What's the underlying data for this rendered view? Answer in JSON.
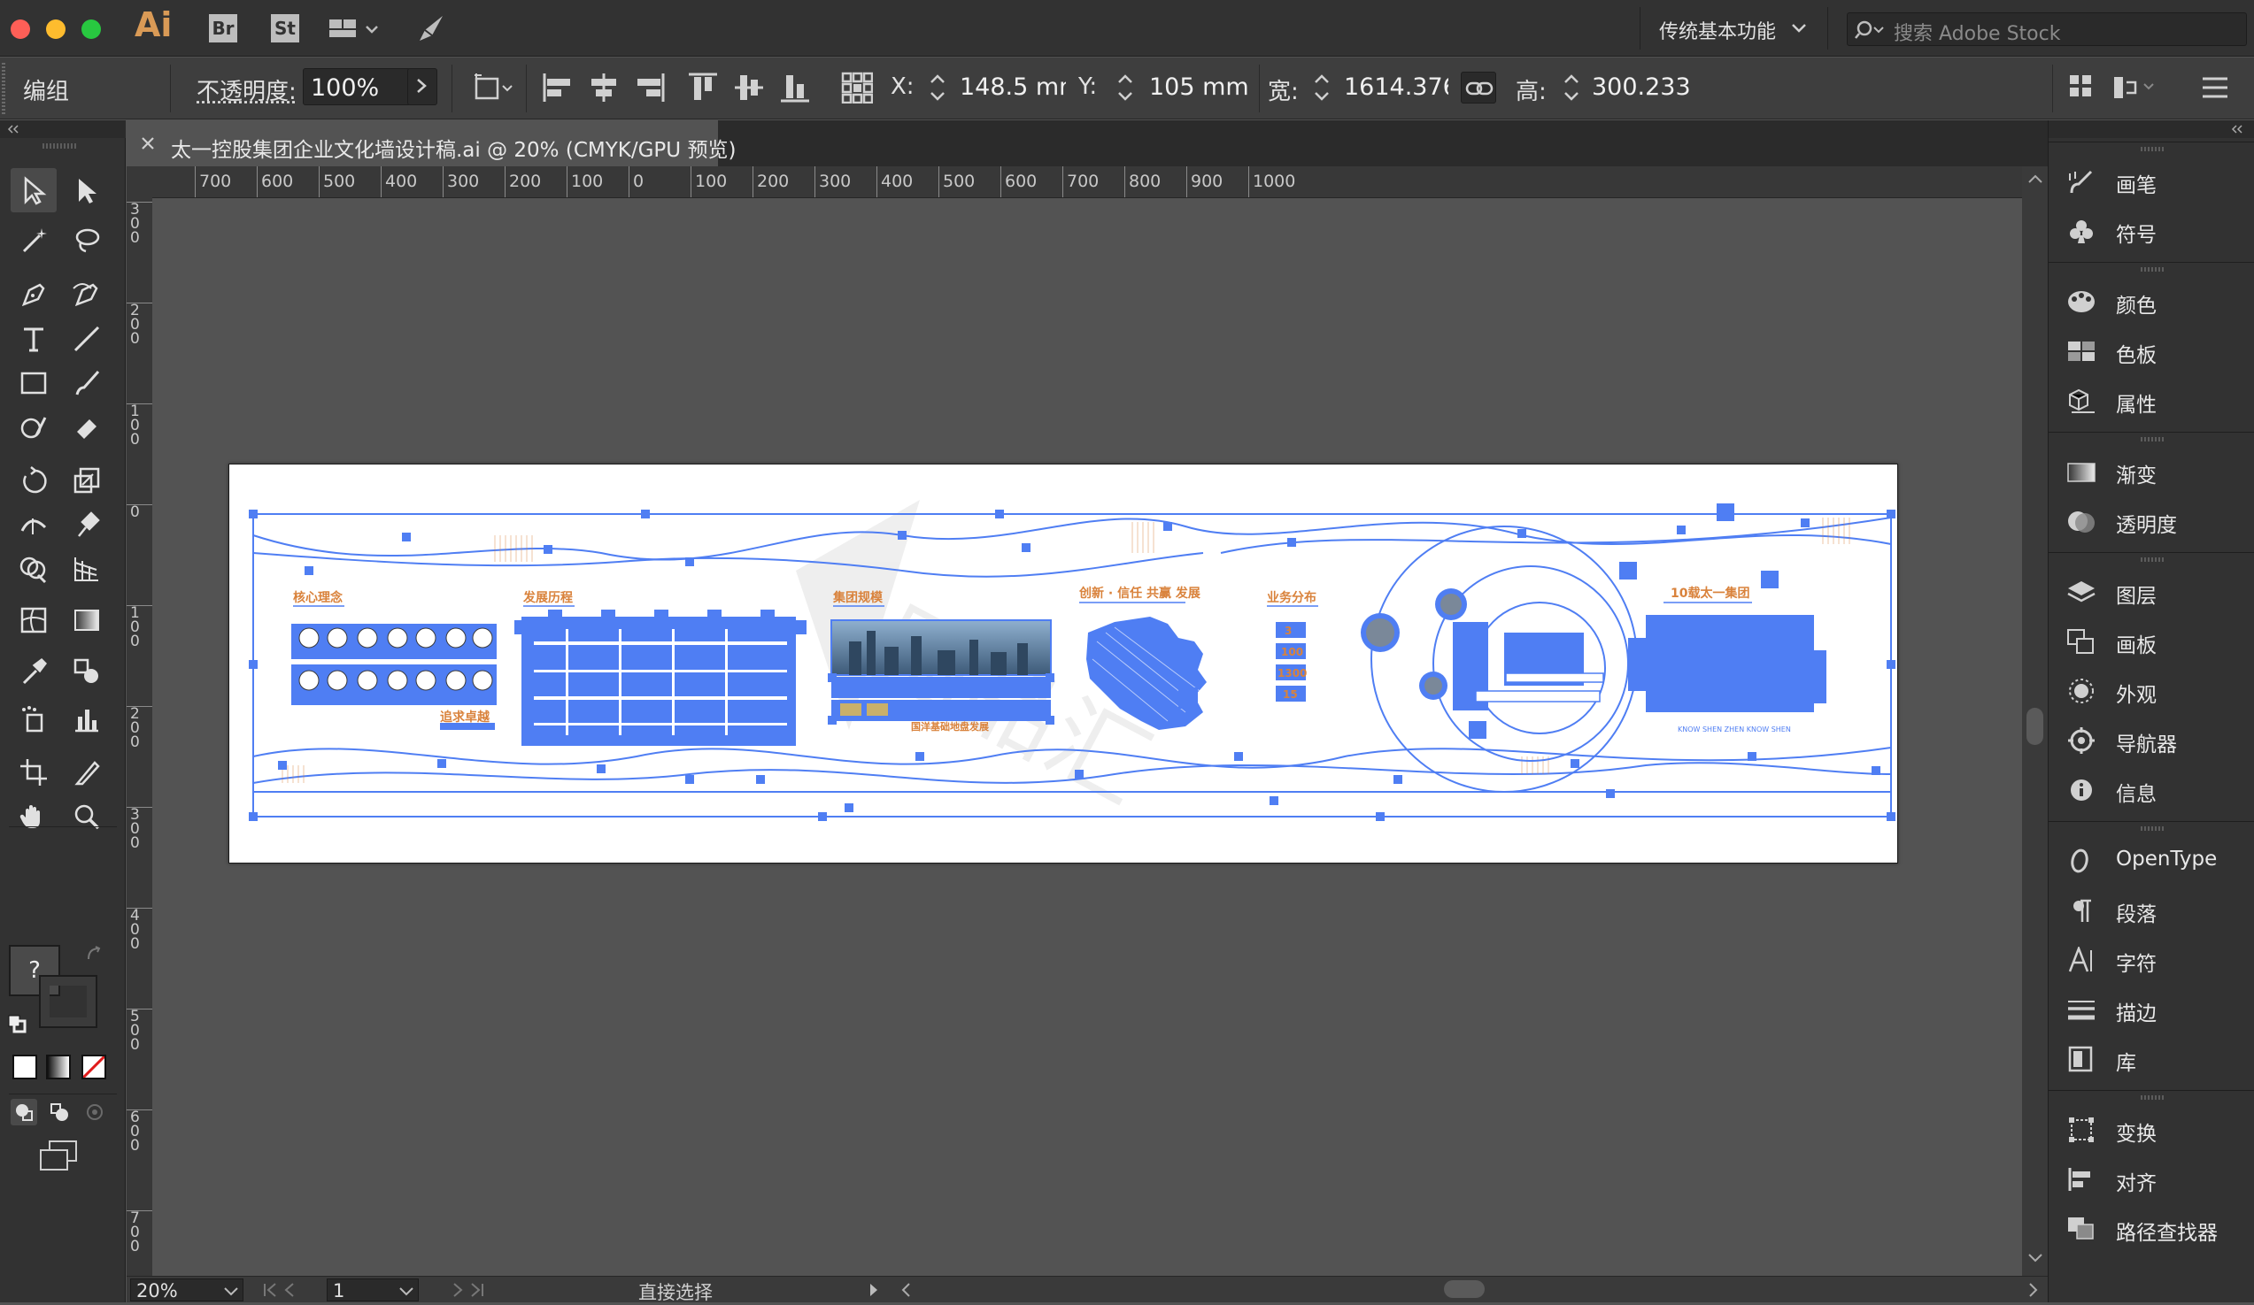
{
  "app": {
    "logo": "Ai",
    "workspace": "传统基本功能",
    "search_placeholder": "搜索 Adobe Stock"
  },
  "titlebar_apps": [
    "Br",
    "St"
  ],
  "control": {
    "selection_type": "编组",
    "opacity_label": "不透明度:",
    "opacity_value": "100%",
    "x_label": "X:",
    "x_value": "148.5 mm",
    "y_label": "Y:",
    "y_value": "105 mm",
    "w_label": "宽:",
    "w_value": "1614.376",
    "h_label": "高:",
    "h_value": "300.233 n"
  },
  "document": {
    "tab_title": "太一控股集团企业文化墙设计稿.ai @ 20% (CMYK/GPU 预览)"
  },
  "ruler": {
    "h_ticks": [
      "700",
      "600",
      "500",
      "400",
      "300",
      "200",
      "100",
      "0",
      "100",
      "200",
      "300",
      "400",
      "500",
      "600",
      "700",
      "800",
      "900",
      "1000"
    ],
    "v_ticks": [
      "300",
      "200",
      "100",
      "0",
      "100",
      "200",
      "300",
      "400",
      "500",
      "600",
      "700"
    ]
  },
  "artwork": {
    "sections": [
      "核心理念",
      "发展历程",
      "集团规模",
      "创新 · 信任 共赢 发展",
      "业务分布",
      "10载太一集团"
    ],
    "subtitles": [
      "追求卓越",
      "国洋基础地盘发展"
    ],
    "stats": [
      "3",
      "100",
      "1300",
      "15"
    ],
    "footer_caption": "KNOW SHEN ZHEN KNOW SHEN"
  },
  "toolbar_fill_hint": "?",
  "status": {
    "zoom": "20%",
    "artboard": "1",
    "tool": "直接选择"
  },
  "panels": {
    "group1": [
      "画笔",
      "符号"
    ],
    "group2": [
      "颜色",
      "色板",
      "属性"
    ],
    "group3": [
      "渐变",
      "透明度"
    ],
    "group4": [
      "图层",
      "画板",
      "外观",
      "导航器",
      "信息"
    ],
    "group5": [
      "OpenType",
      "段落",
      "字符",
      "描边",
      "库"
    ],
    "group6": [
      "变换",
      "对齐",
      "路径查找器"
    ]
  },
  "colors": {
    "accent": "#4f7ef3",
    "orange": "#d9823b",
    "canvas": "#535353",
    "chrome": "#323232"
  }
}
